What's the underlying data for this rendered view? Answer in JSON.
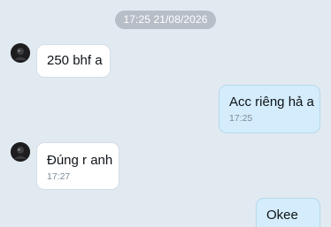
{
  "date_separator": "17:25 21/08/2026",
  "messages": [
    {
      "sender": "contact",
      "text": "250 bhf a",
      "time": ""
    },
    {
      "sender": "me",
      "text": "Acc riêng hả a",
      "time": "17:25"
    },
    {
      "sender": "contact",
      "text": "Đúng r anh",
      "time": "17:27"
    },
    {
      "sender": "me",
      "text": "Okee",
      "time": ""
    }
  ],
  "colors": {
    "background": "#e1e9f1",
    "incoming_bubble": "#ffffff",
    "outgoing_bubble": "#d4ecfb",
    "date_pill": "#b7bec7"
  },
  "icons": {
    "contact_avatar": "avatar-icon"
  }
}
